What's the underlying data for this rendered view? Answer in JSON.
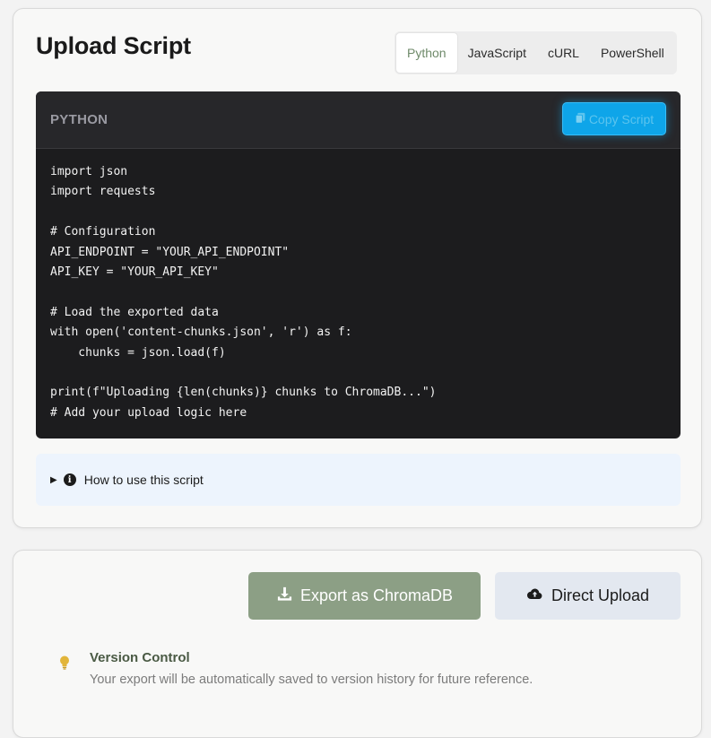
{
  "script_card": {
    "title": "Upload Script",
    "tabs": [
      {
        "label": "Python",
        "active": true
      },
      {
        "label": "JavaScript",
        "active": false
      },
      {
        "label": "cURL",
        "active": false
      },
      {
        "label": "PowerShell",
        "active": false
      }
    ],
    "code": {
      "language": "PYTHON",
      "copy_label": "Copy Script",
      "copy_icon": "copy-icon",
      "content": "import json\nimport requests\n\n# Configuration\nAPI_ENDPOINT = \"YOUR_API_ENDPOINT\"\nAPI_KEY = \"YOUR_API_KEY\"\n\n# Load the exported data\nwith open('content-chunks.json', 'r') as f:\n    chunks = json.load(f)\n\nprint(f\"Uploading {len(chunks)} chunks to ChromaDB...\")\n# Add your upload logic here"
    },
    "howto": {
      "label": "How to use this script",
      "icon": "info-icon"
    }
  },
  "export_card": {
    "export_label": "Export as ChromaDB",
    "export_icon": "download-icon",
    "upload_label": "Direct Upload",
    "upload_icon": "cloud-upload-icon",
    "version": {
      "icon": "lightbulb-icon",
      "title": "Version Control",
      "text": "Your export will be automatically saved to version history for future reference."
    }
  },
  "colors": {
    "accent_green": "#8c9f85",
    "active_tab_text": "#6f8a6a",
    "copy_button": "#0ea5e9",
    "code_bg": "#1c1c1e",
    "howto_bg": "#edf4fd",
    "bulb": "#e2b53a"
  }
}
